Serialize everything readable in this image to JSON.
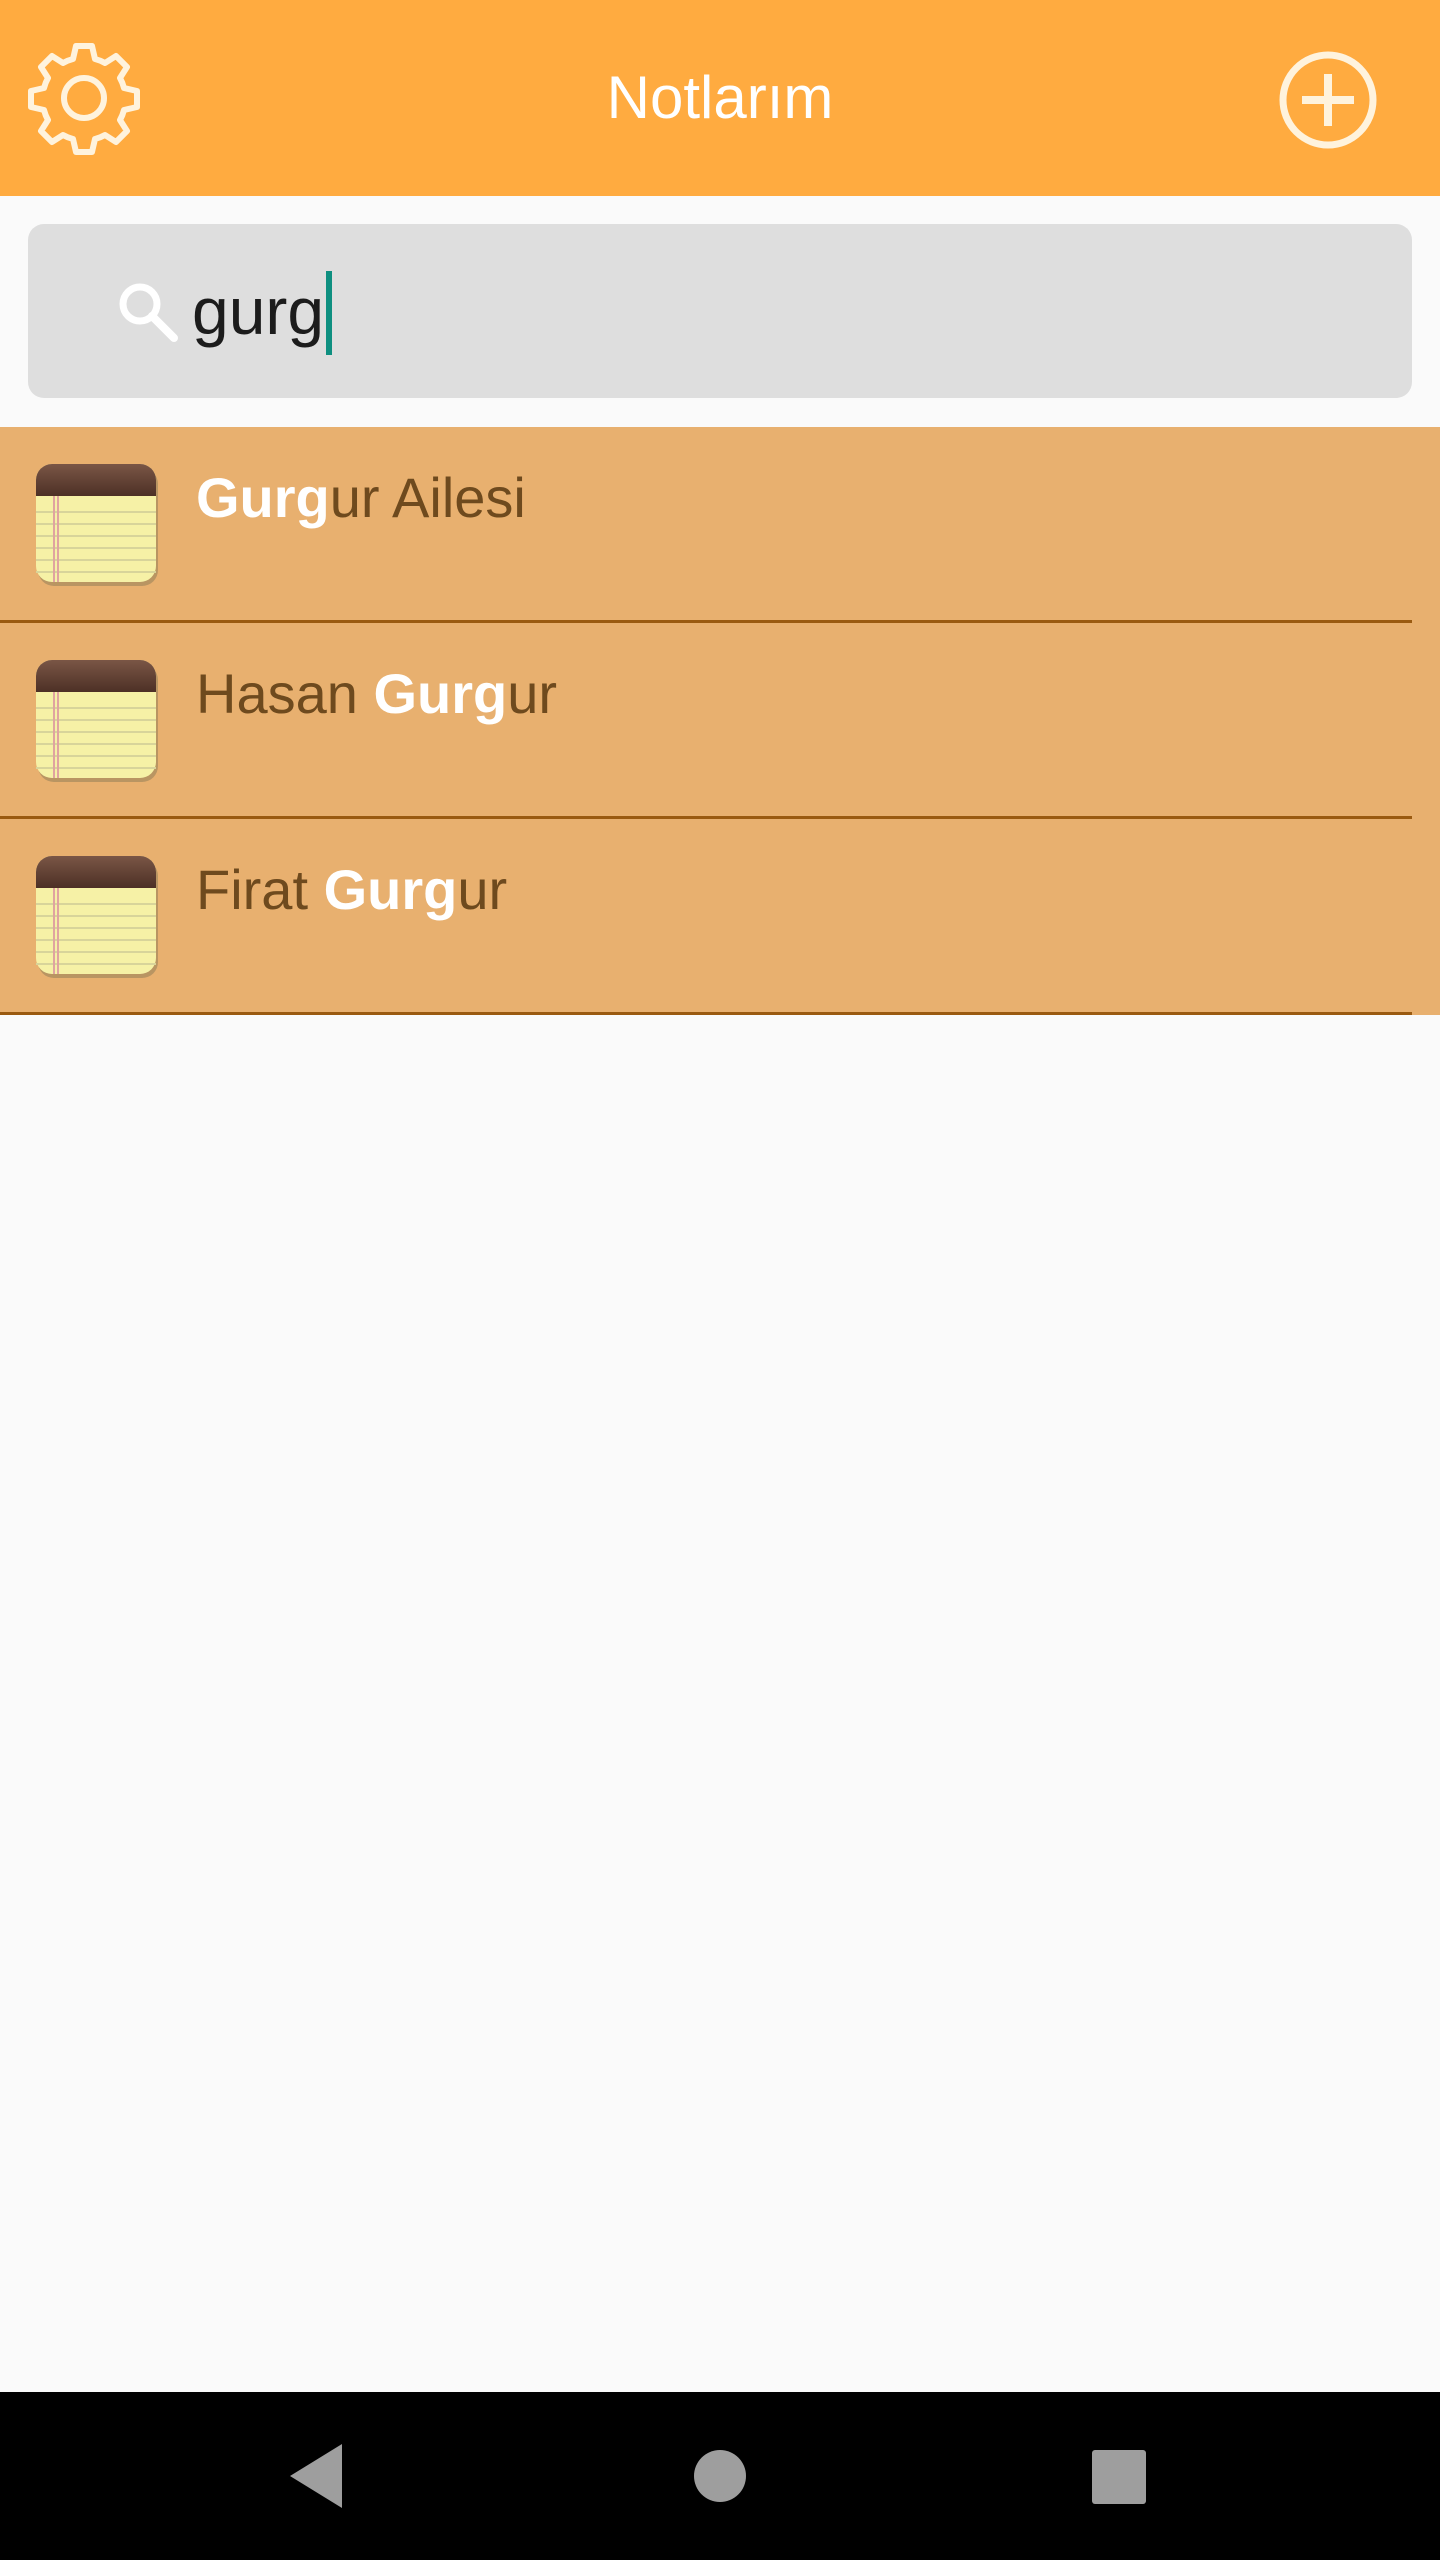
{
  "header": {
    "title": "Notlarım",
    "settings_icon": "gear-icon",
    "add_icon": "plus-circle-icon",
    "background": "#ffab40"
  },
  "search": {
    "icon": "search-icon",
    "query": "gurg"
  },
  "notes": [
    {
      "before": "",
      "match": "Gurg",
      "after": "ur Ailesi"
    },
    {
      "before": "Hasan ",
      "match": "Gurg",
      "after": "ur"
    },
    {
      "before": "Firat ",
      "match": "Gurg",
      "after": "ur"
    }
  ],
  "navigation": {
    "back_icon": "back-triangle-icon",
    "home_icon": "home-circle-icon",
    "recents_icon": "recents-square-icon"
  },
  "colors": {
    "accent": "#ffab40",
    "row_background": "#e8b06f",
    "row_divider": "#9a5a10",
    "caret": "#0e8f80"
  }
}
